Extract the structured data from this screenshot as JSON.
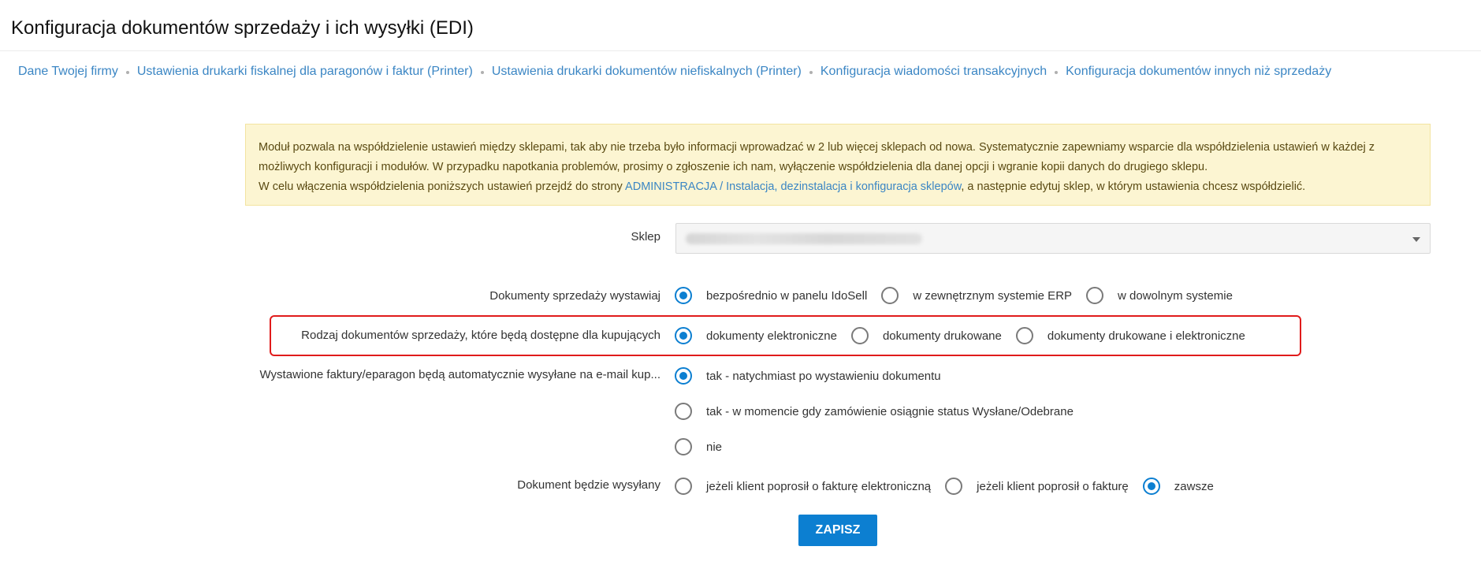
{
  "page": {
    "title": "Konfiguracja dokumentów sprzedaży i ich wysyłki (EDI)"
  },
  "breadcrumb": [
    "Dane Twojej firmy",
    "Ustawienia drukarki fiskalnej dla paragonów i faktur (Printer)",
    "Ustawienia drukarki dokumentów niefiskalnych (Printer)",
    "Konfiguracja wiadomości transakcyjnych",
    "Konfiguracja dokumentów innych niż sprzedaży"
  ],
  "info": {
    "line1": "Moduł pozwala na współdzielenie ustawień między sklepami, tak aby nie trzeba było informacji wprowadzać w 2 lub więcej sklepach od nowa. Systematycznie zapewniamy wsparcie dla współdzielenia ustawień w każdej z możliwych konfiguracji i modułów. W przypadku napotkania problemów, prosimy o zgłoszenie ich nam, wyłączenie współdzielenia dla danej opcji i wgranie kopii danych do drugiego sklepu.",
    "line2_prefix": "W celu włączenia współdzielenia poniższych ustawień przejdź do strony ",
    "line2_link": "ADMINISTRACJA / Instalacja, dezinstalacja i konfiguracja sklepów",
    "line2_suffix": ", a następnie edytuj sklep, w którym ustawienia chcesz współdzielić."
  },
  "shop": {
    "label": "Sklep"
  },
  "issue": {
    "label": "Dokumenty sprzedaży wystawiaj",
    "options": [
      {
        "label": "bezpośrednio w panelu IdoSell",
        "checked": true
      },
      {
        "label": "w zewnętrznym systemie ERP",
        "checked": false
      },
      {
        "label": "w dowolnym systemie",
        "checked": false
      }
    ]
  },
  "doc_type": {
    "label": "Rodzaj dokumentów sprzedaży, które będą dostępne dla kupujących",
    "options": [
      {
        "label": "dokumenty elektroniczne",
        "checked": true
      },
      {
        "label": "dokumenty drukowane",
        "checked": false
      },
      {
        "label": "dokumenty drukowane i elektroniczne",
        "checked": false
      }
    ]
  },
  "auto_send": {
    "label": "Wystawione faktury/eparagon będą automatycznie wysyłane na e-mail kup...",
    "options": [
      {
        "label": "tak - natychmiast po wystawieniu dokumentu",
        "checked": true
      },
      {
        "label": "tak - w momencie gdy zamówienie osiągnie status Wysłane/Odebrane",
        "checked": false
      },
      {
        "label": "nie",
        "checked": false
      }
    ]
  },
  "send_when": {
    "label": "Dokument będzie wysyłany",
    "options": [
      {
        "label": "jeżeli klient poprosił o fakturę elektroniczną",
        "checked": false
      },
      {
        "label": "jeżeli klient poprosił o fakturę",
        "checked": false
      },
      {
        "label": "zawsze",
        "checked": true
      }
    ]
  },
  "actions": {
    "save_label": "ZAPISZ"
  },
  "colors": {
    "accent": "#0c7fd1",
    "link": "#3b86c4",
    "highlight_border": "#e01b1b",
    "info_bg": "#fcf5d2"
  }
}
